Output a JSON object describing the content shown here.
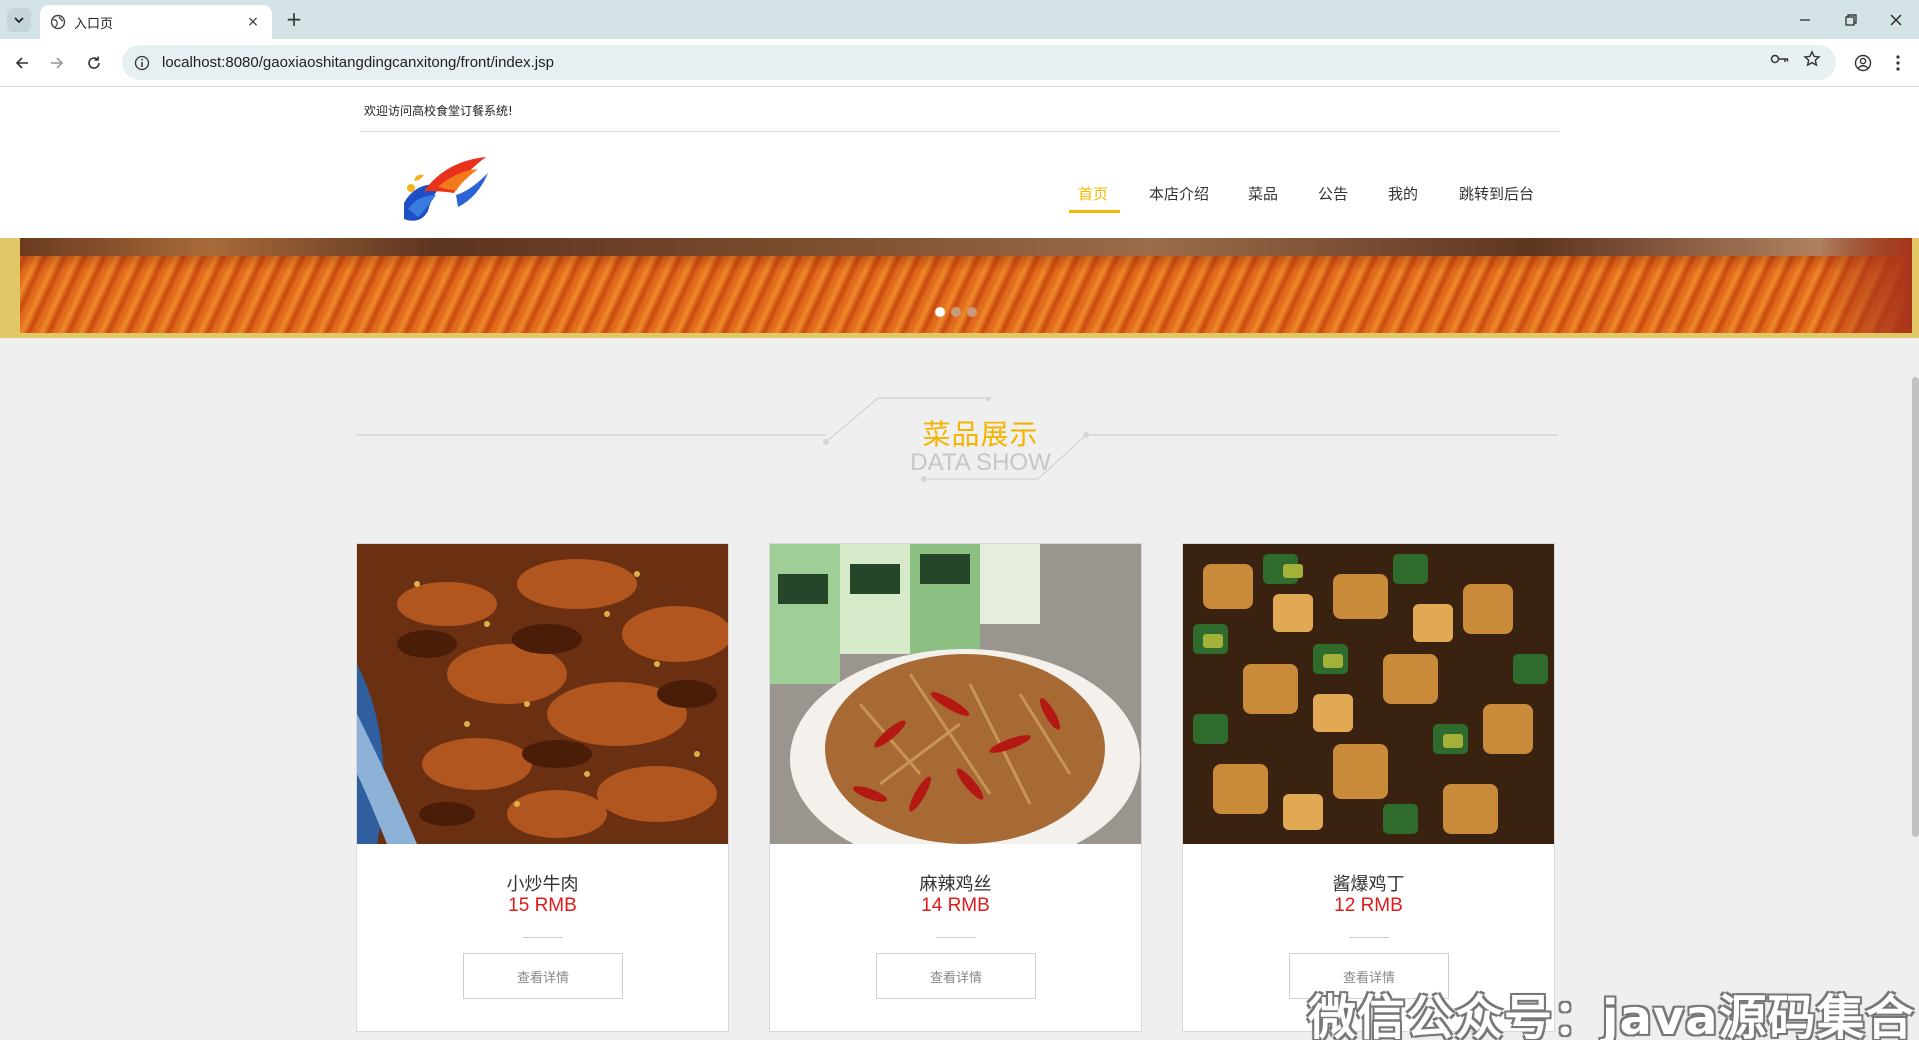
{
  "browser": {
    "tab_title": "入口页",
    "tab_close": "×",
    "new_tab": "+",
    "url": "localhost:8080/gaoxiaoshitangdingcanxitong/front/index.jsp"
  },
  "site": {
    "welcome": "欢迎访问高校食堂订餐系统!",
    "nav": [
      "首页",
      "本店介绍",
      "菜品",
      "公告",
      "我的",
      "跳转到后台"
    ],
    "active_nav": "首页",
    "accent_color": "#f5b800",
    "price_color": "#e01b1b"
  },
  "banner": {
    "slides": 3,
    "active_slide": 1
  },
  "section": {
    "title_cn": "菜品展示",
    "title_en": "DATA SHOW"
  },
  "dishes": [
    {
      "name": "小炒牛肉",
      "price": "15 RMB",
      "button": "查看详情"
    },
    {
      "name": "麻辣鸡丝",
      "price": "14 RMB",
      "button": "查看详情"
    },
    {
      "name": "酱爆鸡丁",
      "price": "12 RMB",
      "button": "查看详情"
    }
  ],
  "watermark": "微信公众号：java源码集合"
}
